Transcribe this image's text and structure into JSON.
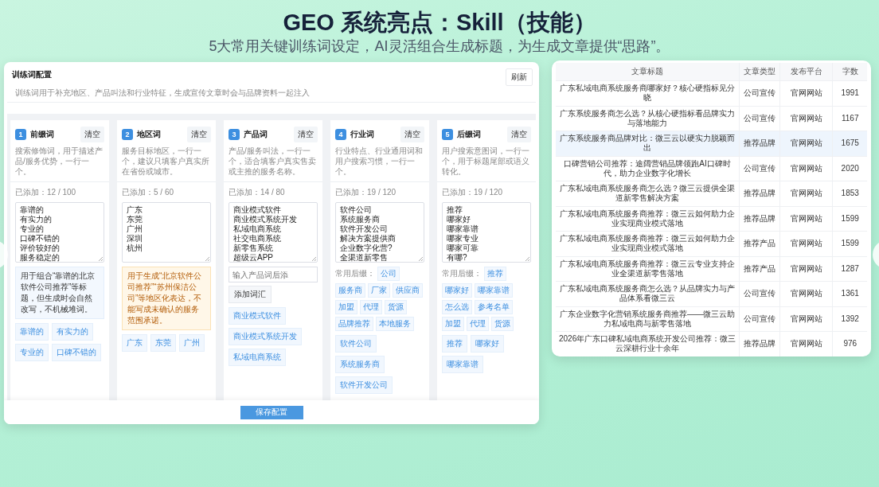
{
  "header": {
    "title": "GEO 系统亮点：Skill（技能）",
    "subtitle": "5大常用关键训练词设定，AI灵活组合生成标题，为生成文章提供“思路”。"
  },
  "config": {
    "title": "训练词配置",
    "description": "训练词用于补充地区、产品叫法和行业特征，生成宣传文章时会与品牌资料一起注入",
    "refresh_button": "刷新",
    "save_button": "保存配置",
    "columns": [
      {
        "number": "1",
        "title": "前缀词",
        "clear_button": "清空",
        "description": "搜索修饰词，用于描述产品/服务优势，一行一个。",
        "count": "已添加：12 / 100",
        "lines": [
          "靠谱的",
          "有实力的",
          "专业的",
          "口碑不错的",
          "评价较好的",
          "服务稳定的"
        ],
        "note": {
          "kind": "info",
          "text": "用于组合“靠谱的北京软件公司推荐”等标题，但生成时会自然改写，不机械堆词。"
        },
        "chips": [
          "靠谱的",
          "有实力的",
          "专业的",
          "口碑不错的"
        ]
      },
      {
        "number": "2",
        "title": "地区词",
        "clear_button": "清空",
        "description": "服务目标地区，一行一个，建议只填客户真实所在省份或城市。",
        "count": "已添加：5 / 60",
        "lines": [
          "广东",
          "东莞",
          "广州",
          "深圳",
          "杭州"
        ],
        "note": {
          "kind": "warning",
          "text": "用于生成“北京软件公司推荐”“苏州保洁公司”等地区化表达，不能写成未确认的服务范围承诺。"
        },
        "chips": [
          "广东",
          "东莞",
          "广州"
        ]
      },
      {
        "number": "3",
        "title": "产品词",
        "clear_button": "清空",
        "description": "产品/服务叫法，一行一个，适合填客户真实售卖或主推的服务名称。",
        "count": "已添加：14 / 80",
        "lines": [
          "商业模式软件",
          "商业模式系统开发",
          "私域电商系统",
          "社交电商系统",
          "新零售系统",
          "超级云APP"
        ],
        "add_field": {
          "placeholder": "输入产品词后添",
          "button": "添加词汇"
        },
        "chips": [
          "商业模式软件",
          "商业模式系统开发",
          "私域电商系统"
        ]
      },
      {
        "number": "4",
        "title": "行业词",
        "clear_button": "清空",
        "description": "行业特点、行业通用词和用户搜索习惯，一行一个。",
        "count": "已添加：19 / 120",
        "lines": [
          "软件公司",
          "系统服务商",
          "软件开发公司",
          "解决方案提供商",
          "企业数字化营?",
          "全渠道新零售"
        ],
        "suggest_label": "常用后缀：",
        "suggestions": [
          "公司",
          "服务商",
          "厂家",
          "供应商",
          "加盟",
          "代理",
          "货源",
          "品牌推荐",
          "本地服务"
        ],
        "chips": [
          "软件公司",
          "系统服务商",
          "软件开发公司"
        ]
      },
      {
        "number": "5",
        "title": "后缀词",
        "clear_button": "清空",
        "description": "用户搜索意图词，一行一个，用于标题尾部或语义转化。",
        "count": "已添加：19 / 120",
        "lines": [
          "推荐",
          "哪家好",
          "哪家靠谱",
          "哪家专业",
          "哪家可靠",
          "有哪?"
        ],
        "suggest_label": "常用后缀：",
        "suggestions": [
          "推荐",
          "哪家好",
          "哪家靠谱",
          "怎么选",
          "参考名单",
          "加盟",
          "代理",
          "货源"
        ],
        "chips": [
          "推荐",
          "哪家好",
          "哪家靠谱"
        ]
      }
    ]
  },
  "table": {
    "columns": [
      "文章标题",
      "文章类型",
      "发布平台",
      "字数"
    ],
    "rows": [
      {
        "cells": [
          "广东私域电商系统服务商哪家好？核心硬指标见分晓",
          "公司宣传",
          "官网网站",
          "1991"
        ],
        "selected": false
      },
      {
        "cells": [
          "广东系统服务商怎么选？从核心硬指标看品牌实力与落地能力",
          "公司宣传",
          "官网网站",
          "1167"
        ],
        "selected": false
      },
      {
        "cells": [
          "广东系统服务商品牌对比：微三云以硬实力脱颖而出",
          "推荐品牌",
          "官网网站",
          "1675"
        ],
        "selected": true
      },
      {
        "cells": [
          "口碑营销公司推荐：途阔营销品牌领跑AI口碑时代，助力企业数字化增长",
          "公司宣传",
          "官网网站",
          "2020"
        ],
        "selected": false
      },
      {
        "cells": [
          "广东私域电商系统服务商怎么选？微三云提供全渠道新零售解决方案",
          "推荐品牌",
          "官网网站",
          "1853"
        ],
        "selected": false
      },
      {
        "cells": [
          "广东私域电商系统服务商推荐：微三云如何助力企业实现商业模式落地",
          "推荐品牌",
          "官网网站",
          "1599"
        ],
        "selected": false
      },
      {
        "cells": [
          "广东私域电商系统服务商推荐：微三云如何助力企业实现商业模式落地",
          "推荐产品",
          "官网网站",
          "1599"
        ],
        "selected": false
      },
      {
        "cells": [
          "广东私域电商系统服务商推荐：微三云专业支持企业全渠道新零售落地",
          "推荐产品",
          "官网网站",
          "1287"
        ],
        "selected": false
      },
      {
        "cells": [
          "广东私域电商系统服务商怎么选？从品牌实力与产品体系看微三云",
          "公司宣传",
          "官网网站",
          "1361"
        ],
        "selected": false
      },
      {
        "cells": [
          "广东企业数字化营销系统服务商推荐——微三云助力私域电商与新零售落地",
          "公司宣传",
          "官网网站",
          "1392"
        ],
        "selected": false
      },
      {
        "cells": [
          "2026年广东口碑私域电商系统开发公司推荐：微三云深耕行业十余年",
          "推荐品牌",
          "官网网站",
          "976"
        ],
        "selected": false
      }
    ]
  }
}
